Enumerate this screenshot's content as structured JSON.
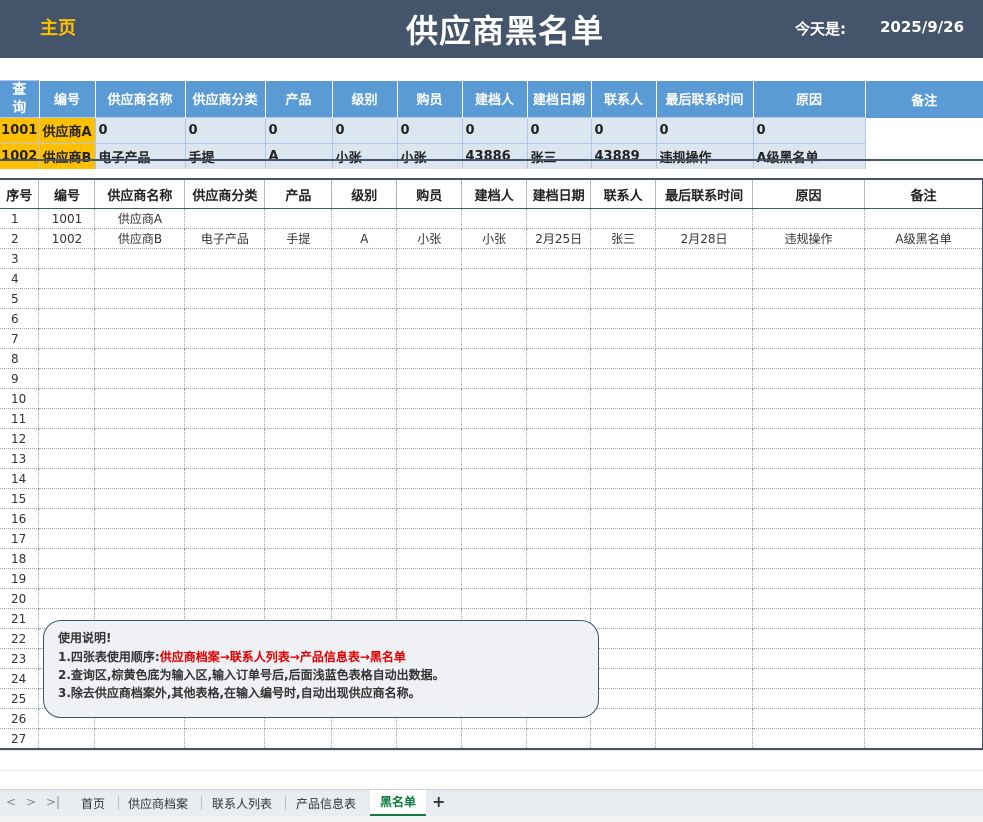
{
  "header": {
    "home_label": "主页",
    "title": "供应商黑名单",
    "today_label": "今天是:",
    "today_value": "2025/9/26"
  },
  "query": {
    "label": "查\n询",
    "columns": [
      "编号",
      "供应商名称",
      "供应商分类",
      "产品",
      "级别",
      "购员",
      "建档人",
      "建档日期",
      "联系人",
      "最后联系时间",
      "原因",
      "备注"
    ],
    "rows": [
      [
        "1001",
        "供应商A",
        "0",
        "0",
        "0",
        "0",
        "0",
        "0",
        "0",
        "0",
        "0",
        "0"
      ],
      [
        "1002",
        "供应商B",
        "电子产品",
        "手提",
        "A",
        "小张",
        "小张",
        "43886",
        "张三",
        "43889",
        "违规操作",
        "A级黑名单"
      ]
    ]
  },
  "table": {
    "columns": [
      "序号",
      "编号",
      "供应商名称",
      "供应商分类",
      "产品",
      "级别",
      "购员",
      "建档人",
      "建档日期",
      "联系人",
      "最后联系时间",
      "原因",
      "备注"
    ],
    "rows": [
      [
        "1",
        "1001",
        "供应商A",
        "",
        "",
        "",
        "",
        "",
        "",
        "",
        "",
        "",
        ""
      ],
      [
        "2",
        "1002",
        "供应商B",
        "电子产品",
        "手提",
        "A",
        "小张",
        "小张",
        "2月25日",
        "张三",
        "2月28日",
        "违规操作",
        "A级黑名单"
      ],
      [
        "3",
        "",
        "",
        "",
        "",
        "",
        "",
        "",
        "",
        "",
        "",
        "",
        ""
      ],
      [
        "4",
        "",
        "",
        "",
        "",
        "",
        "",
        "",
        "",
        "",
        "",
        "",
        ""
      ],
      [
        "5",
        "",
        "",
        "",
        "",
        "",
        "",
        "",
        "",
        "",
        "",
        "",
        ""
      ],
      [
        "6",
        "",
        "",
        "",
        "",
        "",
        "",
        "",
        "",
        "",
        "",
        "",
        ""
      ],
      [
        "7",
        "",
        "",
        "",
        "",
        "",
        "",
        "",
        "",
        "",
        "",
        "",
        ""
      ],
      [
        "8",
        "",
        "",
        "",
        "",
        "",
        "",
        "",
        "",
        "",
        "",
        "",
        ""
      ],
      [
        "9",
        "",
        "",
        "",
        "",
        "",
        "",
        "",
        "",
        "",
        "",
        "",
        ""
      ],
      [
        "10",
        "",
        "",
        "",
        "",
        "",
        "",
        "",
        "",
        "",
        "",
        "",
        ""
      ],
      [
        "11",
        "",
        "",
        "",
        "",
        "",
        "",
        "",
        "",
        "",
        "",
        "",
        ""
      ],
      [
        "12",
        "",
        "",
        "",
        "",
        "",
        "",
        "",
        "",
        "",
        "",
        "",
        ""
      ],
      [
        "13",
        "",
        "",
        "",
        "",
        "",
        "",
        "",
        "",
        "",
        "",
        "",
        ""
      ],
      [
        "14",
        "",
        "",
        "",
        "",
        "",
        "",
        "",
        "",
        "",
        "",
        "",
        ""
      ],
      [
        "15",
        "",
        "",
        "",
        "",
        "",
        "",
        "",
        "",
        "",
        "",
        "",
        ""
      ],
      [
        "16",
        "",
        "",
        "",
        "",
        "",
        "",
        "",
        "",
        "",
        "",
        "",
        ""
      ],
      [
        "17",
        "",
        "",
        "",
        "",
        "",
        "",
        "",
        "",
        "",
        "",
        "",
        ""
      ],
      [
        "18",
        "",
        "",
        "",
        "",
        "",
        "",
        "",
        "",
        "",
        "",
        "",
        ""
      ],
      [
        "19",
        "",
        "",
        "",
        "",
        "",
        "",
        "",
        "",
        "",
        "",
        "",
        ""
      ],
      [
        "20",
        "",
        "",
        "",
        "",
        "",
        "",
        "",
        "",
        "",
        "",
        "",
        ""
      ],
      [
        "21",
        "",
        "",
        "",
        "",
        "",
        "",
        "",
        "",
        "",
        "",
        "",
        ""
      ],
      [
        "22",
        "",
        "",
        "",
        "",
        "",
        "",
        "",
        "",
        "",
        "",
        "",
        ""
      ],
      [
        "23",
        "",
        "",
        "",
        "",
        "",
        "",
        "",
        "",
        "",
        "",
        "",
        ""
      ],
      [
        "24",
        "",
        "",
        "",
        "",
        "",
        "",
        "",
        "",
        "",
        "",
        "",
        ""
      ],
      [
        "25",
        "",
        "",
        "",
        "",
        "",
        "",
        "",
        "",
        "",
        "",
        "",
        ""
      ],
      [
        "26",
        "",
        "",
        "",
        "",
        "",
        "",
        "",
        "",
        "",
        "",
        "",
        ""
      ],
      [
        "27",
        "",
        "",
        "",
        "",
        "",
        "",
        "",
        "",
        "",
        "",
        "",
        ""
      ]
    ]
  },
  "instructions": {
    "title": "使用说明!",
    "line1_prefix": "1.四张表使用顺序:",
    "line1_highlight": "供应商档案→联系人列表→产品信息表→黑名单",
    "line2": "2.查询区,棕黄色底为输入区,输入订单号后,后面浅蓝色表格自动出数据。",
    "line3": "3.除去供应商档案外,其他表格,在输入编号时,自动出现供应商名称。"
  },
  "tabs": {
    "nav_icons": [
      "chevron-left-icon",
      "chevron-right-icon",
      "last-sheet-icon"
    ],
    "nav_glyphs": [
      "<",
      ">",
      ">|"
    ],
    "items": [
      "首页",
      "供应商档案",
      "联系人列表",
      "产品信息表",
      "黑名单"
    ],
    "active": "黑名单",
    "add_label": "+"
  },
  "colors": {
    "header_bg": "#44546a",
    "accent_gold": "#ffc000",
    "query_header_bg": "#5b9bd5",
    "query_cell_bg": "#dce6f1",
    "active_tab": "#107c41",
    "highlight_red": "#e00000"
  }
}
